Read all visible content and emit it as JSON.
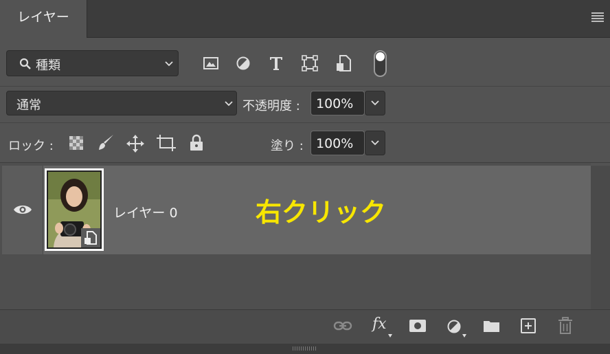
{
  "panel": {
    "tab_label": "レイヤー"
  },
  "filter": {
    "placeholder": "種類"
  },
  "blend": {
    "mode": "通常",
    "opacity_label": "不透明度 :",
    "opacity_value": "100%"
  },
  "lock": {
    "label": "ロック :",
    "fill_label": "塗り :",
    "fill_value": "100%"
  },
  "layer": {
    "name": "レイヤー 0",
    "annotation": "右クリック",
    "annotation_color": "#f7e600"
  },
  "bottom": {
    "fx_label": "fx"
  }
}
